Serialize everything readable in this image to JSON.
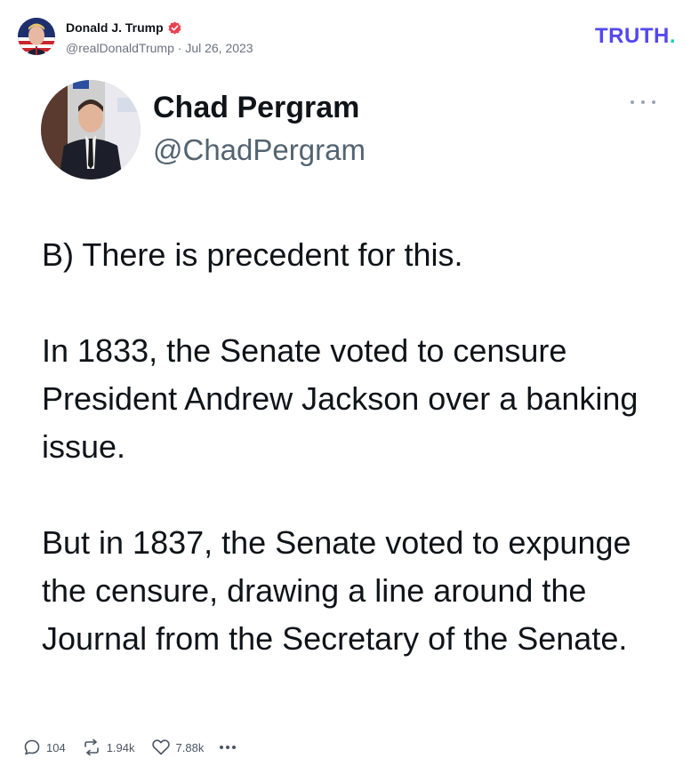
{
  "post": {
    "author_name": "Donald J. Trump",
    "author_handle": "@realDonaldTrump",
    "date_separator": "·",
    "date": "Jul 26, 2023",
    "avatar_icon": "flag-portrait-avatar",
    "verified_icon": "verified-badge-icon",
    "brand_logo": "TRUTH",
    "brand_logo_dot": ".",
    "colors": {
      "brand": "#5448ee",
      "brand_dot": "#1bd0b7",
      "verified": "#e8434f"
    }
  },
  "tweet": {
    "name": "Chad Pergram",
    "handle": "@ChadPergram",
    "paragraphs": [
      "B) There is precedent for this.",
      "In 1833, the Senate voted to censure President Andrew Jackson over a banking issue.",
      "But in 1837, the Senate voted to expunge the censure, drawing a line around the Journal from the Secretary of the Senate."
    ]
  },
  "actions": {
    "replies": "104",
    "retruths": "1.94k",
    "likes": "7.88k",
    "reply_icon": "comment-icon",
    "retruth_icon": "retruth-icon",
    "like_icon": "heart-icon",
    "more_icon": "more-dots-icon"
  }
}
